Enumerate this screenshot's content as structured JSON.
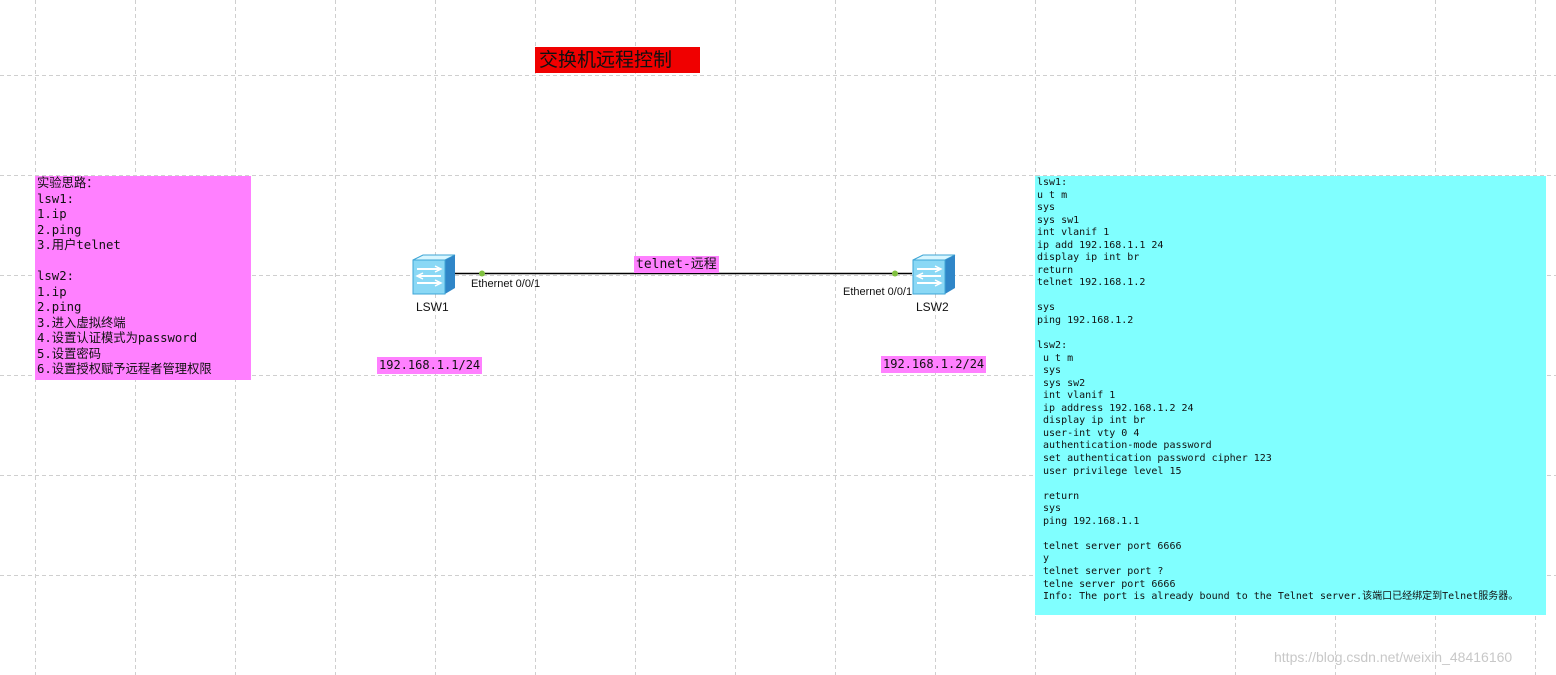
{
  "title": "交换机远程控制",
  "left_notes": {
    "lines": [
      "实验思路：",
      "lsw1:",
      "1.ip",
      "2.ping",
      "3.用户telnet",
      "",
      "lsw2:",
      "1.ip",
      "2.ping",
      "3.进入虚拟终端",
      "4.设置认证模式为password",
      "5.设置密码",
      "6.设置授权赋予远程者管理权限"
    ]
  },
  "topology": {
    "devices": [
      {
        "name": "LSW1",
        "ip": "192.168.1.1/24",
        "port": "Ethernet 0/0/1"
      },
      {
        "name": "LSW2",
        "ip": "192.168.1.2/24",
        "port": "Ethernet 0/0/1"
      }
    ],
    "link_label": "telnet-远程",
    "link_color": "#000000",
    "port_dot_color": "#80c040"
  },
  "right_notes": {
    "lines": [
      "lsw1:",
      "u t m",
      "sys",
      "sys sw1",
      "int vlanif 1",
      "ip add 192.168.1.1 24",
      "display ip int br",
      "return",
      "telnet 192.168.1.2",
      "",
      "sys",
      "ping 192.168.1.2",
      "",
      "lsw2:",
      " u t m",
      " sys",
      " sys sw2",
      " int vlanif 1",
      " ip address 192.168.1.2 24",
      " display ip int br",
      " user-int vty 0 4",
      " authentication-mode password",
      " set authentication password cipher 123",
      " user privilege level 15",
      "",
      " return",
      " sys",
      " ping 192.168.1.1",
      "",
      " telnet server port 6666",
      " y",
      " telnet server port ?",
      " telne server port 6666",
      " Info: The port is already bound to the Telnet server.该端口已经绑定到Telnet服务器。"
    ]
  },
  "colors": {
    "title_bg": "#f00000",
    "pink": "#ff80ff",
    "cyan": "#80ffff",
    "grid": "#cfcfcf"
  },
  "watermark": "https://blog.csdn.net/weixin_48416160"
}
